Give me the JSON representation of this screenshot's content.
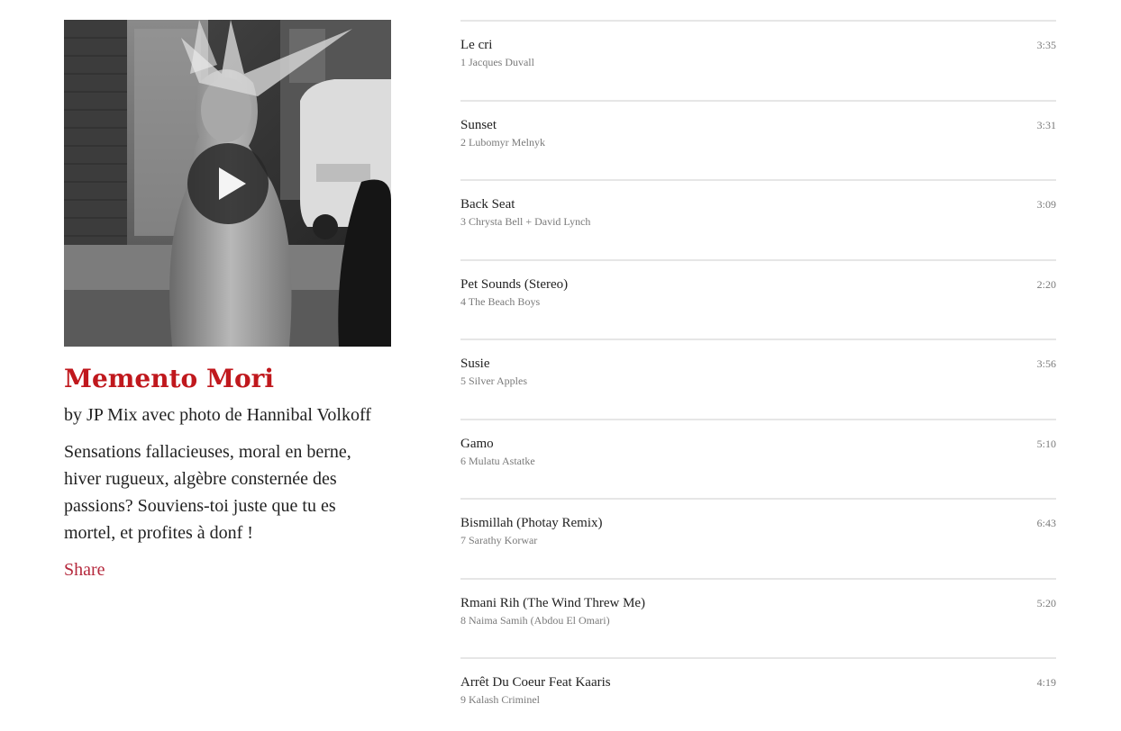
{
  "mix": {
    "title": "Memento Mori",
    "byline": "by JP Mix avec photo de Hannibal Volkoff",
    "description": "Sensations fallacieuses, moral en berne, hiver rugueux, algèbre consternée des passions? Souviens-toi juste que tu es mortel, et profites à donf !",
    "share_label": "Share",
    "title_color": "#c0181d",
    "share_color": "#b5283c"
  },
  "cover": {
    "icon": "play-icon"
  },
  "tracks": [
    {
      "title": "Le cri",
      "number": "1",
      "artist": "Jacques Duvall",
      "duration": "3:35"
    },
    {
      "title": "Sunset",
      "number": "2",
      "artist": "Lubomyr Melnyk",
      "duration": "3:31"
    },
    {
      "title": "Back Seat",
      "number": "3",
      "artist": "Chrysta Bell + David Lynch",
      "duration": "3:09"
    },
    {
      "title": "Pet Sounds (Stereo)",
      "number": "4",
      "artist": "The Beach Boys",
      "duration": "2:20"
    },
    {
      "title": "Susie",
      "number": "5",
      "artist": "Silver Apples",
      "duration": "3:56"
    },
    {
      "title": "Gamo",
      "number": "6",
      "artist": "Mulatu Astatke",
      "duration": "5:10"
    },
    {
      "title": "Bismillah (Photay Remix)",
      "number": "7",
      "artist": "Sarathy Korwar",
      "duration": "6:43"
    },
    {
      "title": "Rmani Rih (The Wind Threw Me)",
      "number": "8",
      "artist": "Naima Samih (Abdou El Omari)",
      "duration": "5:20"
    },
    {
      "title": "Arrêt Du Coeur Feat Kaaris",
      "number": "9",
      "artist": "Kalash Criminel",
      "duration": "4:19"
    }
  ]
}
